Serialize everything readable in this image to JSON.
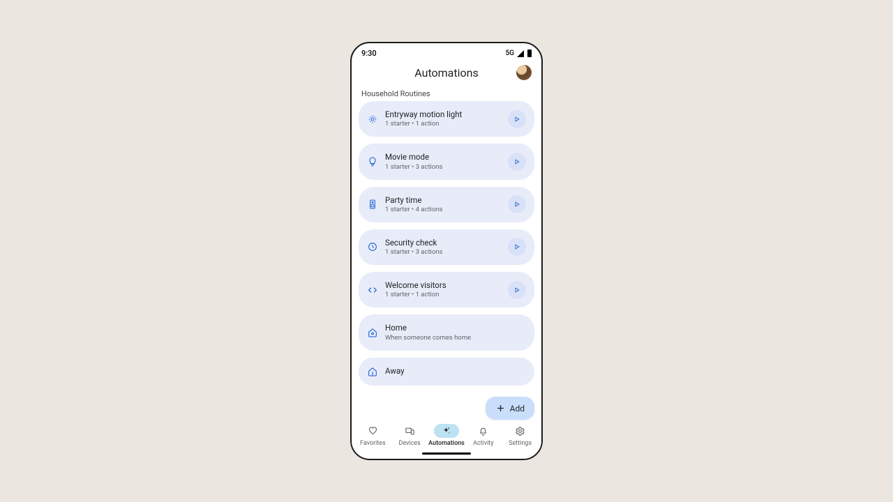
{
  "status": {
    "time": "9:30",
    "network": "5G"
  },
  "header": {
    "title": "Automations"
  },
  "section_label": "Household Routines",
  "routines": [
    {
      "icon": "motion",
      "title": "Entryway motion light",
      "sub": "1 starter • 1 action",
      "play": true
    },
    {
      "icon": "bulb",
      "title": "Movie mode",
      "sub": "1 starter • 3 actions",
      "play": true
    },
    {
      "icon": "speaker",
      "title": "Party time",
      "sub": "1 starter • 4 actions",
      "play": true
    },
    {
      "icon": "clock",
      "title": "Security check",
      "sub": "1 starter • 3 actions",
      "play": true
    },
    {
      "icon": "code",
      "title": "Welcome visitors",
      "sub": "1 starter • 1 action",
      "play": true
    },
    {
      "icon": "home",
      "title": "Home",
      "sub": "When someone comes home",
      "play": false
    },
    {
      "icon": "away",
      "title": "Away",
      "sub": "",
      "play": false
    }
  ],
  "fab": {
    "label": "Add"
  },
  "nav": [
    {
      "label": "Favorites",
      "icon": "heart",
      "active": false
    },
    {
      "label": "Devices",
      "icon": "devices",
      "active": false
    },
    {
      "label": "Automations",
      "icon": "sparkle",
      "active": true
    },
    {
      "label": "Activity",
      "icon": "bell",
      "active": false
    },
    {
      "label": "Settings",
      "icon": "gear",
      "active": false
    }
  ]
}
